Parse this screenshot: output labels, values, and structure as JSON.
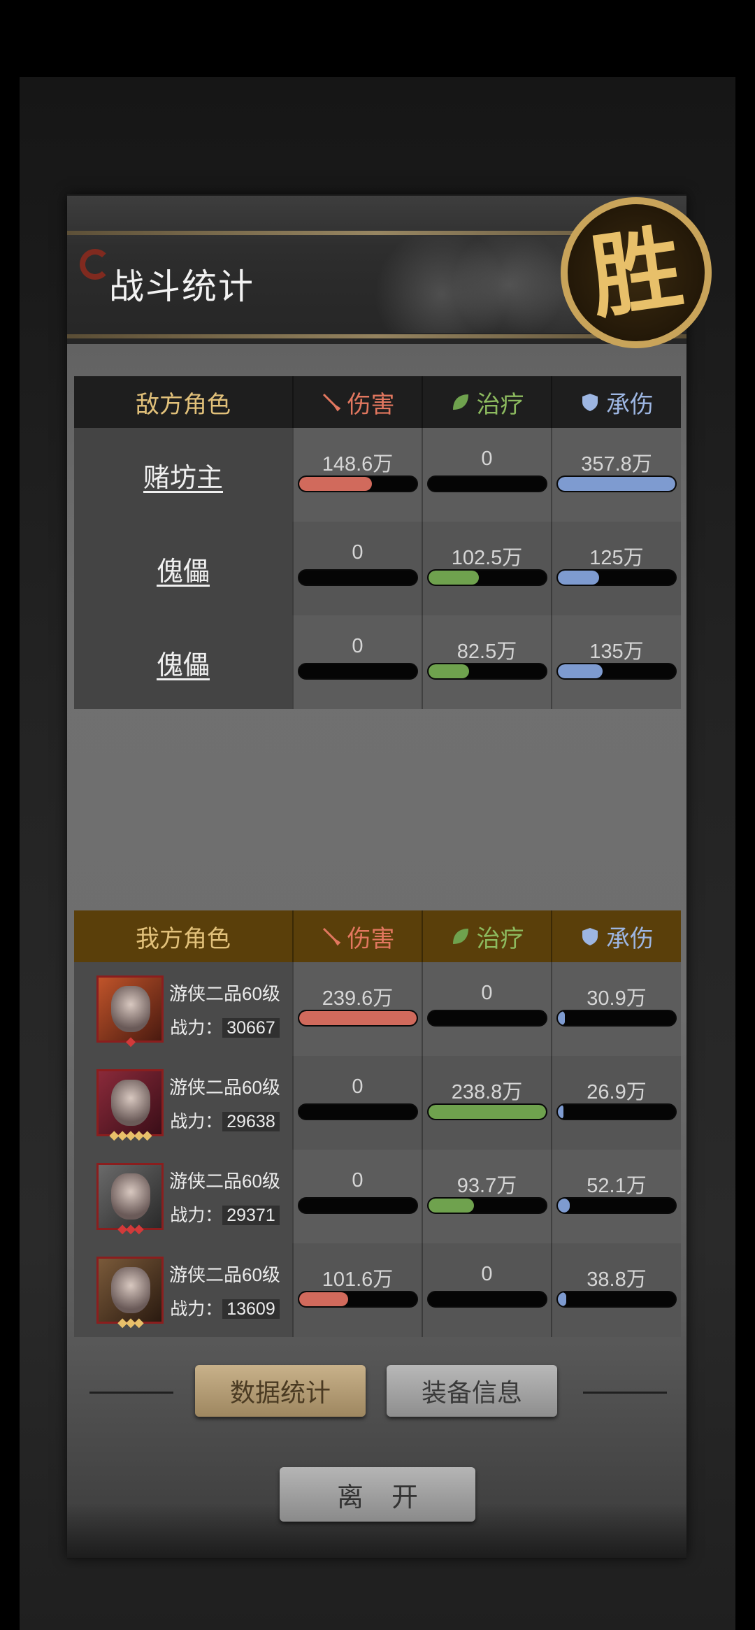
{
  "header": {
    "title": "战斗统计",
    "result_seal": "胜"
  },
  "enemy": {
    "header": {
      "role": "敌方角色",
      "damage": "伤害",
      "heal": "治疗",
      "tank": "承伤"
    },
    "rows": [
      {
        "name": "赌坊主",
        "damage": "148.6万",
        "heal": "0",
        "tank": "357.8万",
        "damage_ratio": 0.62,
        "heal_ratio": 0,
        "tank_ratio": 1.0
      },
      {
        "name": "傀儡",
        "damage": "0",
        "heal": "102.5万",
        "tank": "125万",
        "damage_ratio": 0,
        "heal_ratio": 0.43,
        "tank_ratio": 0.35
      },
      {
        "name": "傀儡",
        "damage": "0",
        "heal": "82.5万",
        "tank": "135万",
        "damage_ratio": 0,
        "heal_ratio": 0.35,
        "tank_ratio": 0.38
      }
    ]
  },
  "ally": {
    "header": {
      "role": "我方角色",
      "damage": "伤害",
      "heal": "治疗",
      "tank": "承伤"
    },
    "rows": [
      {
        "rank": "游侠二品60级",
        "power_label": "战力：",
        "power": "30667",
        "damage": "239.6万",
        "heal": "0",
        "tank": "30.9万",
        "damage_ratio": 1.0,
        "heal_ratio": 0,
        "tank_ratio": 0.06,
        "stars": "◆",
        "star_color": "red"
      },
      {
        "rank": "游侠二品60级",
        "power_label": "战力：",
        "power": "29638",
        "damage": "0",
        "heal": "238.8万",
        "tank": "26.9万",
        "damage_ratio": 0,
        "heal_ratio": 1.0,
        "tank_ratio": 0.05,
        "stars": "◆◆◆◆◆",
        "star_color": "gold"
      },
      {
        "rank": "游侠二品60级",
        "power_label": "战力：",
        "power": "29371",
        "damage": "0",
        "heal": "93.7万",
        "tank": "52.1万",
        "damage_ratio": 0,
        "heal_ratio": 0.39,
        "tank_ratio": 0.1,
        "stars": "◆◆◆",
        "star_color": "red"
      },
      {
        "rank": "游侠二品60级",
        "power_label": "战力：",
        "power": "13609",
        "damage": "101.6万",
        "heal": "0",
        "tank": "38.8万",
        "damage_ratio": 0.42,
        "heal_ratio": 0,
        "tank_ratio": 0.07,
        "stars": "◆◆◆",
        "star_color": "gold"
      }
    ]
  },
  "buttons": {
    "stats": "数据统计",
    "equip": "装备信息",
    "leave": "离开"
  }
}
